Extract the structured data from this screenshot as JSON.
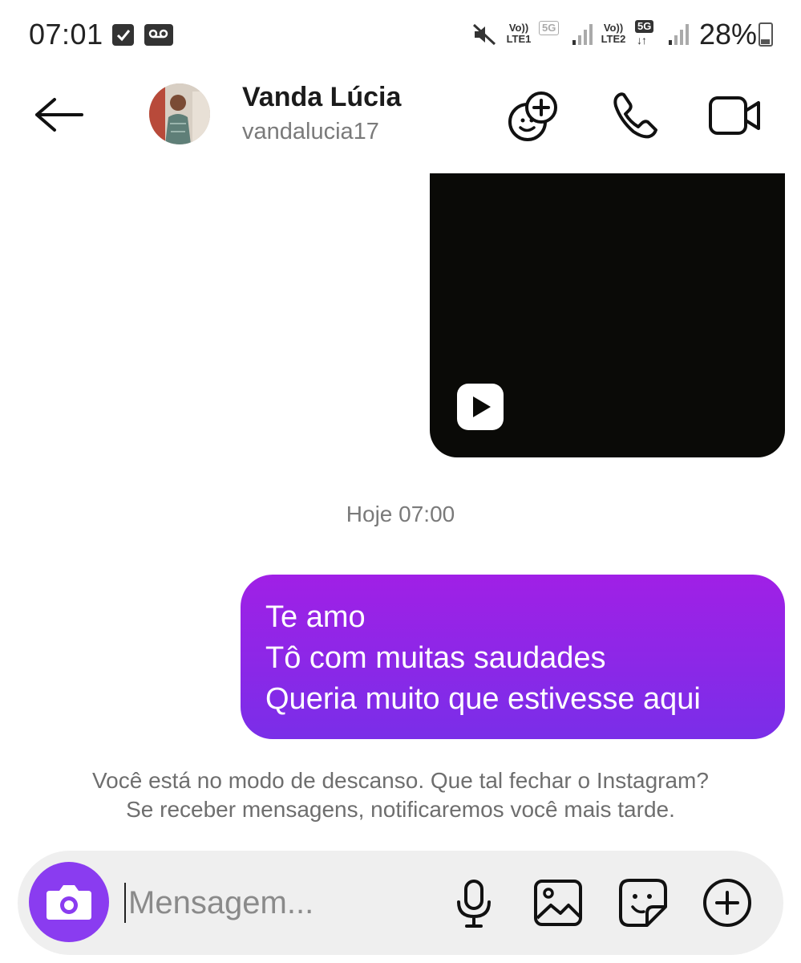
{
  "status_bar": {
    "time": "07:01",
    "sim1_label": "Vo))\nLTE1",
    "sim1_top": "Vo))",
    "sim1_bottom": "LTE1",
    "sim1_badge": "5G",
    "sim2_top": "Vo))",
    "sim2_bottom": "LTE2",
    "sim2_badge": "5G",
    "sim2_arrows": "↓↑",
    "battery": "28%",
    "battery_level": 0.28,
    "icons": [
      "checkbox-icon",
      "voicemail-icon",
      "mute-icon",
      "signal-icon",
      "battery-charging-icon"
    ]
  },
  "header": {
    "name": "Vanda Lúcia",
    "username": "vandalucia17",
    "icons": [
      "back-arrow-icon",
      "effects-icon",
      "phone-icon",
      "video-camera-icon"
    ]
  },
  "messages": {
    "video_icon": "play-icon",
    "timestamp": "Hoje 07:00",
    "bubble_lines": [
      "Te amo",
      "Tô com muitas saudades",
      "Queria muito que estivesse aqui"
    ]
  },
  "rest_notice": {
    "line1": "Você está no modo de descanso. Que tal fechar o Instagram?",
    "line2": "Se receber mensagens, notificaremos você mais tarde."
  },
  "composer": {
    "placeholder": "Mensagem...",
    "icons": [
      "camera-icon",
      "microphone-icon",
      "gallery-icon",
      "sticker-icon",
      "plus-icon"
    ]
  },
  "colors": {
    "accent": "#8a3cf0",
    "bubble_top": "#a020e6",
    "bubble_bottom": "#7a2ee8"
  }
}
